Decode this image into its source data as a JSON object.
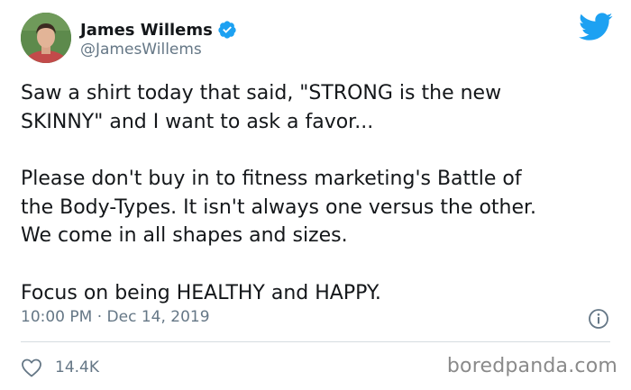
{
  "author": {
    "display_name": "James Willems",
    "handle": "@JamesWillems",
    "verified": true
  },
  "tweet": {
    "paragraphs": [
      "Saw a shirt today that said, \"STRONG is the new\nSKINNY\" and I want to ask a favor...",
      "Please don't buy in to fitness marketing's Battle of\nthe Body-Types. It isn't always one versus the other.\nWe come in all shapes and sizes.",
      "Focus on being HEALTHY and HAPPY."
    ],
    "timestamp": "10:00 PM · Dec 14, 2019",
    "like_count": "14.4K"
  },
  "icons": {
    "brand": "twitter-bird-icon",
    "verified": "verified-badge-icon",
    "info": "info-icon",
    "like": "heart-icon"
  },
  "colors": {
    "twitter_blue": "#1da1f2",
    "text_primary": "#14171a",
    "text_secondary": "#657786",
    "divider": "#d6dce0",
    "watermark": "#8a8a8a"
  },
  "watermark": "boredpanda.com"
}
